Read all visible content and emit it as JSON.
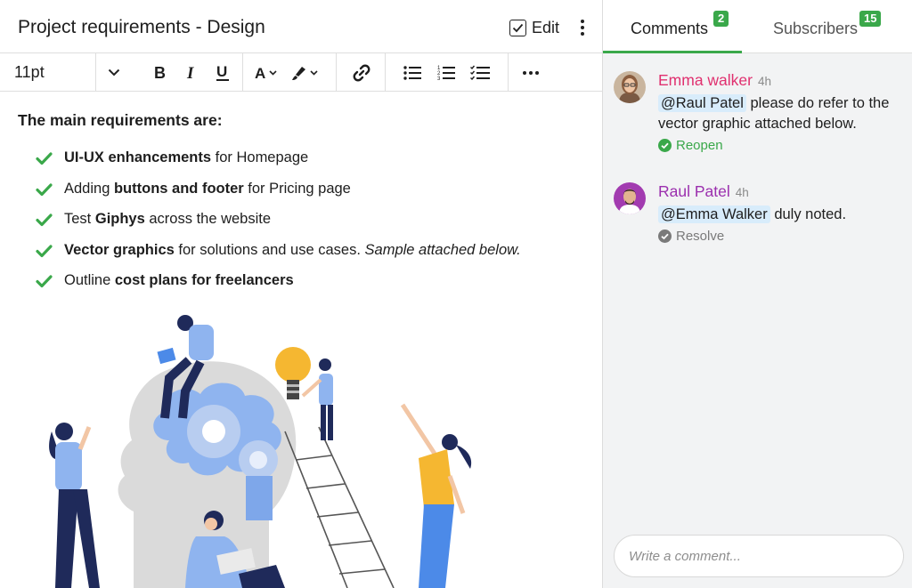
{
  "document": {
    "title": "Project requirements - Design",
    "edit_label": "Edit"
  },
  "toolbar": {
    "font_size": "11pt"
  },
  "content": {
    "intro": "The main requirements are:",
    "items": [
      {
        "parts": [
          {
            "text": "UI-UX enhancements",
            "style": "bold"
          },
          {
            "text": " for Homepage",
            "style": "normal"
          }
        ]
      },
      {
        "parts": [
          {
            "text": "Adding ",
            "style": "normal"
          },
          {
            "text": "buttons and footer",
            "style": "bold"
          },
          {
            "text": " for Pricing page",
            "style": "normal"
          }
        ]
      },
      {
        "parts": [
          {
            "text": "Test ",
            "style": "normal"
          },
          {
            "text": "Giphys",
            "style": "bold"
          },
          {
            "text": " across the website",
            "style": "normal"
          }
        ]
      },
      {
        "parts": [
          {
            "text": "Vector graphics",
            "style": "bold"
          },
          {
            "text": " for solutions and use cases. ",
            "style": "normal"
          },
          {
            "text": "Sample attached below.",
            "style": "italic"
          }
        ]
      },
      {
        "parts": [
          {
            "text": "Outline ",
            "style": "normal"
          },
          {
            "text": "cost plans for freelancers",
            "style": "bold"
          }
        ]
      }
    ]
  },
  "sidebar": {
    "tabs": [
      {
        "label": "Comments",
        "count": "2",
        "active": true
      },
      {
        "label": "Subscribers",
        "count": "15",
        "active": false
      }
    ],
    "comments": [
      {
        "author": "Emma walker",
        "time": "4h",
        "mention": "@Raul Patel",
        "text": " please do refer to the vector graphic attached below.",
        "action": "Reopen"
      },
      {
        "author": "Raul Patel",
        "time": "4h",
        "mention": "@Emma Walker",
        "text": " duly noted.",
        "action": "Resolve"
      }
    ],
    "input_placeholder": "Write a comment..."
  },
  "colors": {
    "accent_green": "#3aa84a",
    "author_emma": "#e0306f",
    "author_raul": "#9b2fae",
    "mention_bg": "#d8ecfb",
    "resolve_gray": "#7a7a7a"
  }
}
